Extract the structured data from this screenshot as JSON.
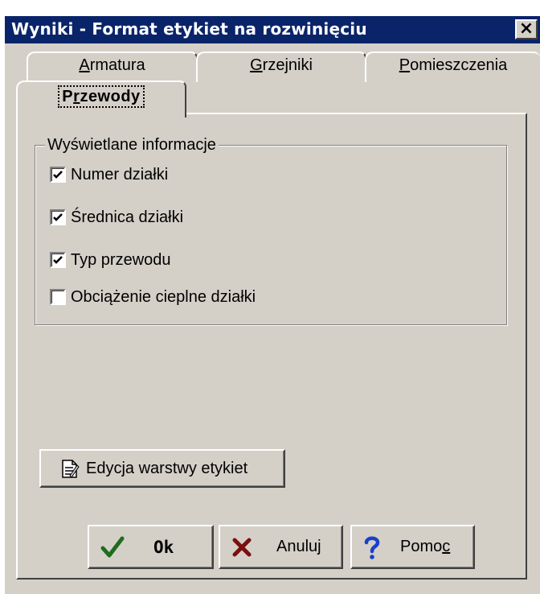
{
  "window": {
    "title": "Wyniki - Format etykiet na rozwinięciu",
    "close_glyph": "×"
  },
  "tabs": [
    {
      "label_mnemonic": "A",
      "label_rest": "rmatura",
      "active": false
    },
    {
      "label_mnemonic": "G",
      "label_rest": "rzejniki",
      "active": false
    },
    {
      "label_mnemonic": "P",
      "label_rest": "omieszczenia",
      "active": false
    },
    {
      "label_head": "P",
      "label_mnemonic": "r",
      "label_rest": "zewody",
      "active": true
    }
  ],
  "group": {
    "label": "Wyświetlane informacje",
    "checkboxes": [
      {
        "label": "Numer działki",
        "checked": true
      },
      {
        "label": "Średnica działki",
        "checked": true
      },
      {
        "label": "Typ przewodu",
        "checked": true
      },
      {
        "label": "Obciążenie cieplne działki",
        "checked": false
      }
    ]
  },
  "buttons": {
    "edycja": {
      "label": "Edycja warstwy etykiet",
      "icon": "document-edit-icon"
    },
    "ok": {
      "label": "Ok",
      "icon": "checkmark-icon",
      "icon_color": "#1f6b1f"
    },
    "anuluj": {
      "label": "Anuluj",
      "icon": "cross-icon",
      "icon_color": "#7a0f0f"
    },
    "pomoc": {
      "label_head": "Pomo",
      "label_mnemonic": "c",
      "icon": "question-mark-icon",
      "icon_color": "#1a3fc8"
    }
  },
  "colors": {
    "titlebar": "#0a246a",
    "face": "#d4d0c8"
  }
}
